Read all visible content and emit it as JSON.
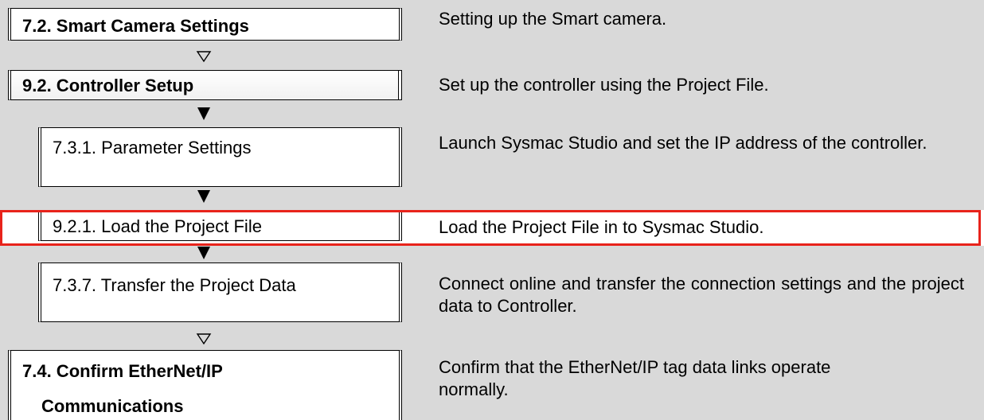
{
  "steps": [
    {
      "id": "smart-camera-settings",
      "title": "7.2. Smart Camera Settings",
      "description": "Setting up the Smart camera.",
      "arrow_after": "hollow-down-triangle"
    },
    {
      "id": "controller-setup",
      "title": "9.2. Controller Setup",
      "description": "Set up the controller using the Project File.",
      "arrow_after": "solid-down-triangle"
    },
    {
      "id": "parameter-settings",
      "title": "7.3.1. Parameter Settings",
      "description": "Launch Sysmac Studio and set the IP address of the controller.",
      "arrow_after": "solid-down-triangle"
    },
    {
      "id": "load-project-file",
      "title": "9.2.1. Load the Project File",
      "description": "Load the Project File in to Sysmac Studio.",
      "highlighted": true,
      "arrow_after": "solid-down-triangle"
    },
    {
      "id": "transfer-project-data",
      "title": "7.3.7. Transfer the Project Data",
      "description": "Connect online and transfer the connection settings and the project data to Controller.",
      "arrow_after": "hollow-down-triangle"
    },
    {
      "id": "confirm-ethernet-ip",
      "title_line1": "7.4. Confirm EtherNet/IP",
      "title_line2": "Communications",
      "description": "Confirm that the EtherNet/IP tag data links operate normally."
    }
  ],
  "colors": {
    "band": "#d9d9d9",
    "highlight_border": "#e8231b",
    "box_border": "#000000"
  },
  "icons": {
    "hollow_arrow": "hollow-down-triangle-icon",
    "solid_arrow": "solid-down-triangle-icon"
  }
}
